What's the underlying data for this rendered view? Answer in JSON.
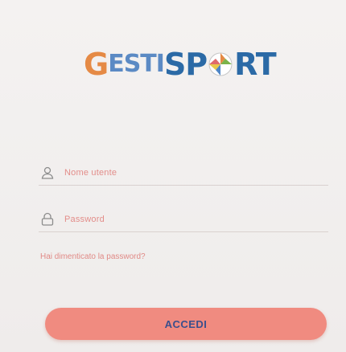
{
  "logo": {
    "text_g": "G",
    "text_esti": "ESTI",
    "text_sp": "SP",
    "text_rt": "RT"
  },
  "login": {
    "username_placeholder": "Nome utente",
    "password_placeholder": "Password",
    "forgot_link": "Hai dimenticato la password?",
    "submit_label": "ACCEDI"
  },
  "colors": {
    "accent": "#f08b80",
    "logo_blue": "#2b6aa6",
    "logo_orange": "#e58a45"
  }
}
